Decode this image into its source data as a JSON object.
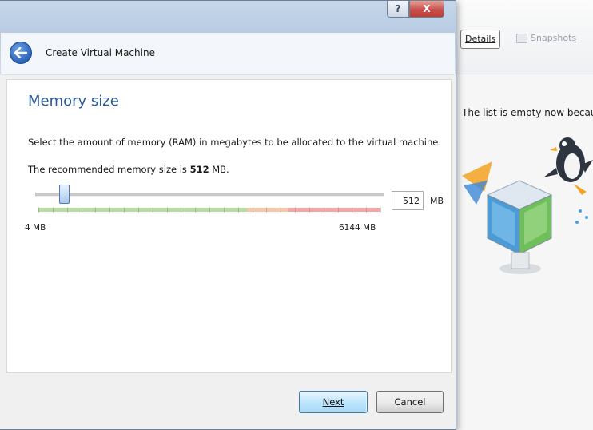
{
  "background_window": {
    "tabs": [
      "Details",
      "Snapshots"
    ],
    "empty_message": "The list is empty now because"
  },
  "dialog": {
    "title": "Create Virtual Machine",
    "caption_buttons": {
      "help": "?",
      "close": "X"
    },
    "page_title": "Memory size",
    "description": "Select the amount of memory (RAM) in megabytes to be allocated to the virtual machine.",
    "recommended_prefix": "The recommended memory size is ",
    "recommended_value": "512",
    "recommended_suffix": " MB.",
    "slider": {
      "min_label": "4 MB",
      "max_label": "6144 MB",
      "min_mb": 4,
      "max_mb": 6144,
      "value_mb": 512
    },
    "memory_value": "512",
    "memory_unit": "MB",
    "buttons": {
      "next": "Next",
      "cancel": "Cancel"
    }
  },
  "colors": {
    "page_title": "#2a5a9c",
    "scale_green": "#b6dca2",
    "scale_orange": "#f4c7a8",
    "scale_red": "#f4a5a5"
  }
}
